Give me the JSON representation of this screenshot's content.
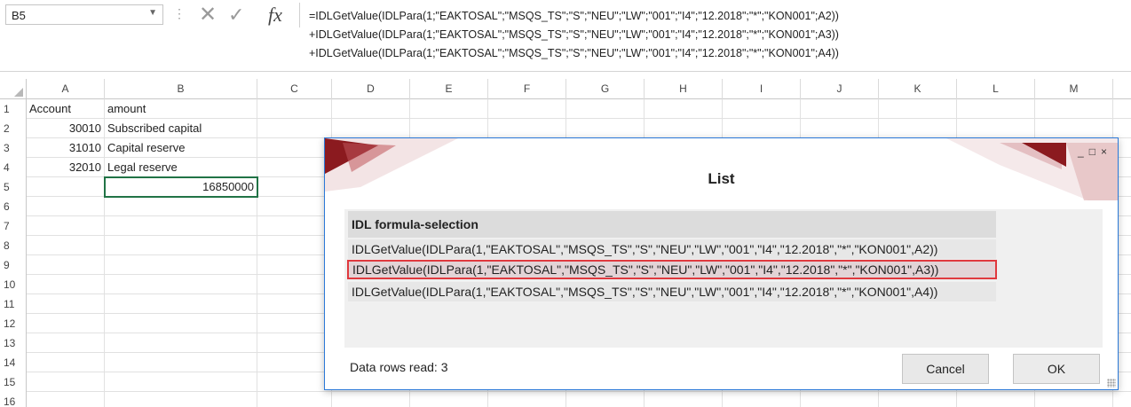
{
  "formula_bar": {
    "name_box": "B5",
    "formula_lines": [
      "=IDLGetValue(IDLPara(1;\"EAKTOSAL\";\"MSQS_TS\";\"S\";\"NEU\";\"LW\";\"001\";\"I4\";\"12.2018\";\"*\";\"KON001\";A2))",
      "+IDLGetValue(IDLPara(1;\"EAKTOSAL\";\"MSQS_TS\";\"S\";\"NEU\";\"LW\";\"001\";\"I4\";\"12.2018\";\"*\";\"KON001\";A3))",
      "+IDLGetValue(IDLPara(1;\"EAKTOSAL\";\"MSQS_TS\";\"S\";\"NEU\";\"LW\";\"001\";\"I4\";\"12.2018\";\"*\";\"KON001\";A4))"
    ],
    "fx_label": "fx"
  },
  "columns": [
    "A",
    "B",
    "C",
    "D",
    "E",
    "F",
    "G",
    "H",
    "I",
    "J",
    "K",
    "L",
    "M"
  ],
  "rows": [
    "1",
    "2",
    "3",
    "4",
    "5",
    "6",
    "7",
    "8",
    "9",
    "10",
    "11",
    "12",
    "13",
    "14",
    "15",
    "16"
  ],
  "cells": {
    "A1": "Account",
    "B1": "amount",
    "A2": "30010",
    "B2": "Subscribed capital",
    "A3": "31010",
    "B3": "Capital reserve",
    "A4": "32010",
    "B4": "Legal reserve",
    "B5": "16850000"
  },
  "dialog": {
    "title": "List",
    "list_header": "IDL formula-selection",
    "items": [
      "IDLGetValue(IDLPara(1,\"EAKTOSAL\",\"MSQS_TS\",\"S\",\"NEU\",\"LW\",\"001\",\"I4\",\"12.2018\",\"*\",\"KON001\",A2))",
      "IDLGetValue(IDLPara(1,\"EAKTOSAL\",\"MSQS_TS\",\"S\",\"NEU\",\"LW\",\"001\",\"I4\",\"12.2018\",\"*\",\"KON001\",A3))",
      "IDLGetValue(IDLPara(1,\"EAKTOSAL\",\"MSQS_TS\",\"S\",\"NEU\",\"LW\",\"001\",\"I4\",\"12.2018\",\"*\",\"KON001\",A4))"
    ],
    "selected_index": 1,
    "status": "Data rows read: 3",
    "cancel_label": "Cancel",
    "ok_label": "OK",
    "window_controls": [
      "_",
      "□",
      "×"
    ]
  },
  "colors": {
    "accent_red": "#8b1a1f",
    "selection_border": "#e0383e",
    "excel_green": "#217346",
    "dialog_border": "#2b79d8"
  }
}
